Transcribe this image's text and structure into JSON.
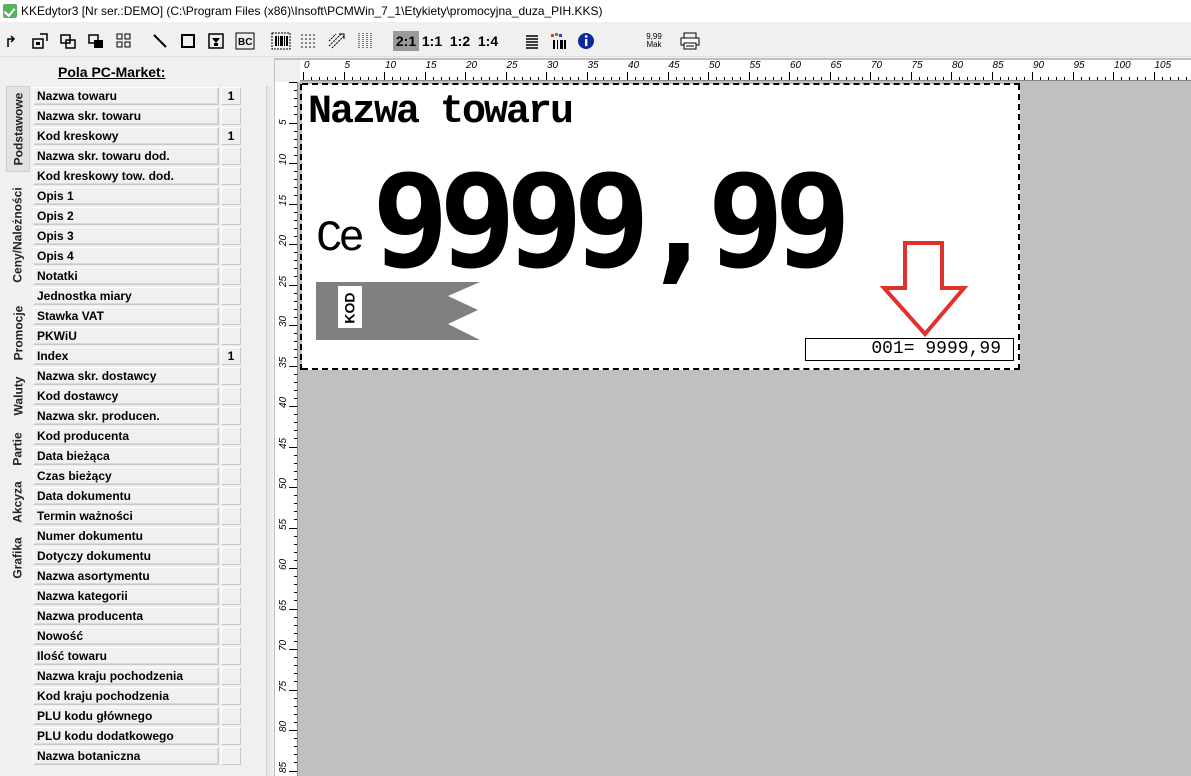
{
  "window": {
    "title": "KKEdytor3 [Nr ser.:DEMO] (C:\\Program Files (x86)\\Insoft\\PCMWin_7_1\\Etykiety\\promocyjna_duza_PIH.KKS)"
  },
  "toolbar": {
    "zoom_levels": [
      "2:1",
      "1:1",
      "1:2",
      "1:4"
    ],
    "zoom_active": "2:1",
    "price_icon_top": "9,99",
    "price_icon_bottom": "Mak"
  },
  "left_panel": {
    "title": "Pola PC-Market:",
    "tabs": [
      "Podstawowe",
      "Ceny/Należności",
      "Promocje",
      "Waluty",
      "Partie",
      "Akcyza",
      "Grafika"
    ],
    "active_tab": "Podstawowe",
    "fields": [
      {
        "name": "Nazwa towaru",
        "count": "1"
      },
      {
        "name": "Nazwa skr. towaru",
        "count": ""
      },
      {
        "name": "Kod kreskowy",
        "count": "1"
      },
      {
        "name": "Nazwa skr. towaru dod.",
        "count": ""
      },
      {
        "name": "Kod kreskowy tow. dod.",
        "count": ""
      },
      {
        "name": "Opis 1",
        "count": ""
      },
      {
        "name": "Opis 2",
        "count": ""
      },
      {
        "name": "Opis 3",
        "count": ""
      },
      {
        "name": "Opis 4",
        "count": ""
      },
      {
        "name": "Notatki",
        "count": ""
      },
      {
        "name": "Jednostka miary",
        "count": ""
      },
      {
        "name": "Stawka VAT",
        "count": ""
      },
      {
        "name": "PKWiU",
        "count": ""
      },
      {
        "name": "Index",
        "count": "1"
      },
      {
        "name": "Nazwa skr. dostawcy",
        "count": ""
      },
      {
        "name": "Kod dostawcy",
        "count": ""
      },
      {
        "name": "Nazwa skr. producen.",
        "count": ""
      },
      {
        "name": "Kod producenta",
        "count": ""
      },
      {
        "name": "Data bieżąca",
        "count": ""
      },
      {
        "name": "Czas bieżący",
        "count": ""
      },
      {
        "name": "Data dokumentu",
        "count": ""
      },
      {
        "name": "Termin ważności",
        "count": ""
      },
      {
        "name": "Numer dokumentu",
        "count": ""
      },
      {
        "name": "Dotyczy dokumentu",
        "count": ""
      },
      {
        "name": "Nazwa asortymentu",
        "count": ""
      },
      {
        "name": "Nazwa kategorii",
        "count": ""
      },
      {
        "name": "Nazwa producenta",
        "count": ""
      },
      {
        "name": "Nowość",
        "count": ""
      },
      {
        "name": "Ilość towaru",
        "count": ""
      },
      {
        "name": "Nazwa kraju pochodzenia",
        "count": ""
      },
      {
        "name": "Kod kraju pochodzenia",
        "count": ""
      },
      {
        "name": "PLU kodu głównego",
        "count": ""
      },
      {
        "name": "PLU kodu dodatkowego",
        "count": ""
      },
      {
        "name": "Nazwa botaniczna",
        "count": ""
      }
    ]
  },
  "rulers": {
    "horizontal_labels": [
      "0",
      "5",
      "10",
      "15",
      "20",
      "25",
      "30",
      "35",
      "40",
      "45",
      "50",
      "55",
      "60",
      "65",
      "70",
      "75",
      "80",
      "85",
      "90",
      "95",
      "100",
      "105"
    ],
    "vertical_labels": [
      "5",
      "10",
      "15",
      "20",
      "25",
      "30",
      "35",
      "40",
      "45",
      "50",
      "55",
      "60",
      "65",
      "70",
      "75",
      "80",
      "85"
    ]
  },
  "label": {
    "product_name": "Nazwa towaru",
    "price_prefix": "Ce",
    "price_big": "9999,99",
    "barcode_text": "KOD",
    "small_price": "001= 9999,99"
  },
  "colors": {
    "canvas_bg": "#c0c0c0",
    "label_bg": "#ffffff",
    "barcode_gray": "#808080",
    "arrow_red": "#e0312b"
  }
}
